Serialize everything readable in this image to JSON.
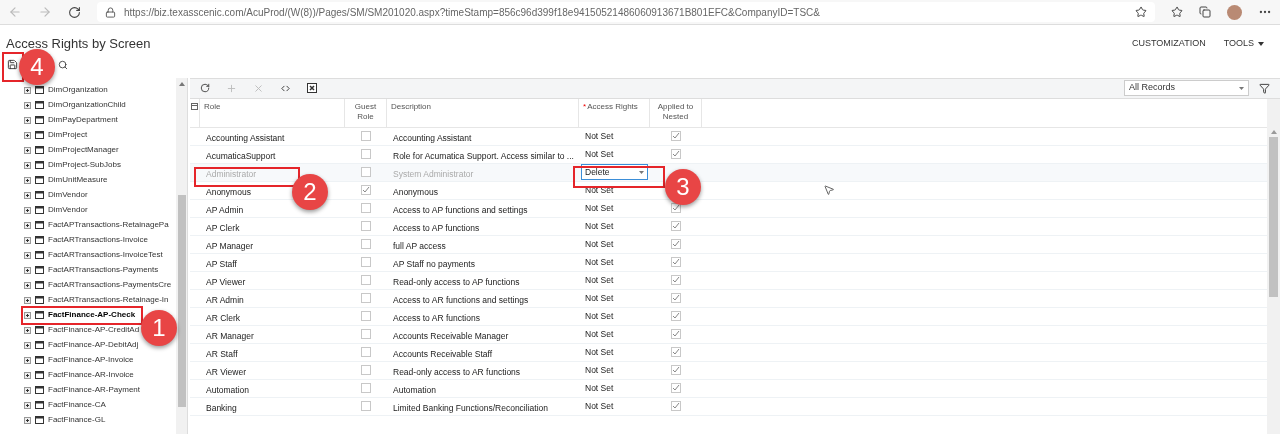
{
  "browser": {
    "url": "https://biz.texasscenic.com/AcuProd/(W(8))/Pages/SM/SM201020.aspx?timeStamp=856c96d399f18e94150521486060913671B801EFC&CompanyID=TSC&"
  },
  "page": {
    "title": "Access Rights by Screen",
    "top_links": [
      {
        "label": "CUSTOMIZATION",
        "kind": "link"
      },
      {
        "label": "TOOLS",
        "kind": "menu"
      }
    ]
  },
  "tree": {
    "items": [
      {
        "label": "DimOrganization",
        "selected": false
      },
      {
        "label": "DimOrganizationChild",
        "selected": false
      },
      {
        "label": "DimPayDepartment",
        "selected": false
      },
      {
        "label": "DimProject",
        "selected": false
      },
      {
        "label": "DimProjectManager",
        "selected": false
      },
      {
        "label": "DimProject-SubJobs",
        "selected": false
      },
      {
        "label": "DimUnitMeasure",
        "selected": false
      },
      {
        "label": "DimVendor",
        "selected": false
      },
      {
        "label": "DimVendor",
        "selected": false
      },
      {
        "label": "FactAPTransactions-RetainagePa",
        "selected": false
      },
      {
        "label": "FactARTransactions-Invoice",
        "selected": false
      },
      {
        "label": "FactARTransactions-InvoiceTest",
        "selected": false
      },
      {
        "label": "FactARTransactions-Payments",
        "selected": false
      },
      {
        "label": "FactARTransactions-PaymentsCre",
        "selected": false
      },
      {
        "label": "FactARTransactions-Retainage-In",
        "selected": false
      },
      {
        "label": "FactFinance-AP-Check",
        "selected": true
      },
      {
        "label": "FactFinance-AP-CreditAd",
        "selected": false
      },
      {
        "label": "FactFinance-AP-DebitAdj",
        "selected": false
      },
      {
        "label": "FactFinance-AP-Invoice",
        "selected": false
      },
      {
        "label": "FactFinance-AR-Invoice",
        "selected": false
      },
      {
        "label": "FactFinance-AR-Payment",
        "selected": false
      },
      {
        "label": "FactFinance-CA",
        "selected": false
      },
      {
        "label": "FactFinance-GL",
        "selected": false
      }
    ]
  },
  "grid": {
    "filter": {
      "value": "All Records"
    },
    "columns": [
      {
        "label": "Role"
      },
      {
        "label": "Guest Role"
      },
      {
        "label": "Description"
      },
      {
        "label": "Access Rights",
        "required_mark": "*"
      },
      {
        "label": "Applied to Nested"
      }
    ],
    "rows": [
      {
        "role": "Accounting Assistant",
        "guest_role": false,
        "description": "Accounting Assistant",
        "access_rights": "Not Set",
        "applied_to_nested": true,
        "disabled": false,
        "editing": false
      },
      {
        "role": "AcumaticaSupport",
        "guest_role": false,
        "description": "Role for Acumatica Support. Access similar to ...",
        "access_rights": "Not Set",
        "applied_to_nested": true,
        "disabled": false,
        "editing": false
      },
      {
        "role": "Administrator",
        "guest_role": false,
        "description": "System Administrator",
        "access_rights": "Delete",
        "disabled": true,
        "editing": true
      },
      {
        "role": "Anonymous",
        "guest_role": true,
        "description": "Anonymous",
        "access_rights": "Not Set",
        "disabled": false,
        "editing": false
      },
      {
        "role": "AP Admin",
        "guest_role": false,
        "description": "Access to AP functions and settings",
        "access_rights": "Not Set",
        "applied_to_nested": true,
        "disabled": false,
        "editing": false
      },
      {
        "role": "AP Clerk",
        "guest_role": false,
        "description": "Access to AP functions",
        "access_rights": "Not Set",
        "applied_to_nested": true,
        "disabled": false,
        "editing": false
      },
      {
        "role": "AP Manager",
        "guest_role": false,
        "description": "full AP access",
        "access_rights": "Not Set",
        "applied_to_nested": true,
        "disabled": false,
        "editing": false
      },
      {
        "role": "AP Staff",
        "guest_role": false,
        "description": "AP Staff no payments",
        "access_rights": "Not Set",
        "applied_to_nested": true,
        "disabled": false,
        "editing": false
      },
      {
        "role": "AP Viewer",
        "guest_role": false,
        "description": "Read-only access to AP functions",
        "access_rights": "Not Set",
        "applied_to_nested": true,
        "disabled": false,
        "editing": false
      },
      {
        "role": "AR Admin",
        "guest_role": false,
        "description": "Access to AR functions and settings",
        "access_rights": "Not Set",
        "applied_to_nested": true,
        "disabled": false,
        "editing": false
      },
      {
        "role": "AR Clerk",
        "guest_role": false,
        "description": "Access to AR functions",
        "access_rights": "Not Set",
        "applied_to_nested": true,
        "disabled": false,
        "editing": false
      },
      {
        "role": "AR Manager",
        "guest_role": false,
        "description": "Accounts Receivable Manager",
        "access_rights": "Not Set",
        "applied_to_nested": true,
        "disabled": false,
        "editing": false
      },
      {
        "role": "AR Staff",
        "guest_role": false,
        "description": "Accounts Receivable Staff",
        "access_rights": "Not Set",
        "applied_to_nested": true,
        "disabled": false,
        "editing": false
      },
      {
        "role": "AR Viewer",
        "guest_role": false,
        "description": "Read-only access to AR functions",
        "access_rights": "Not Set",
        "applied_to_nested": true,
        "disabled": false,
        "editing": false
      },
      {
        "role": "Automation",
        "guest_role": false,
        "description": "Automation",
        "access_rights": "Not Set",
        "applied_to_nested": true,
        "disabled": false,
        "editing": false
      },
      {
        "role": "Banking",
        "guest_role": false,
        "description": "Limited Banking Functions/Reconciliation",
        "access_rights": "Not Set",
        "applied_to_nested": true,
        "disabled": false,
        "editing": false
      }
    ]
  },
  "annotations": [
    {
      "number": "4"
    },
    {
      "number": "1"
    },
    {
      "number": "2"
    },
    {
      "number": "3"
    }
  ]
}
